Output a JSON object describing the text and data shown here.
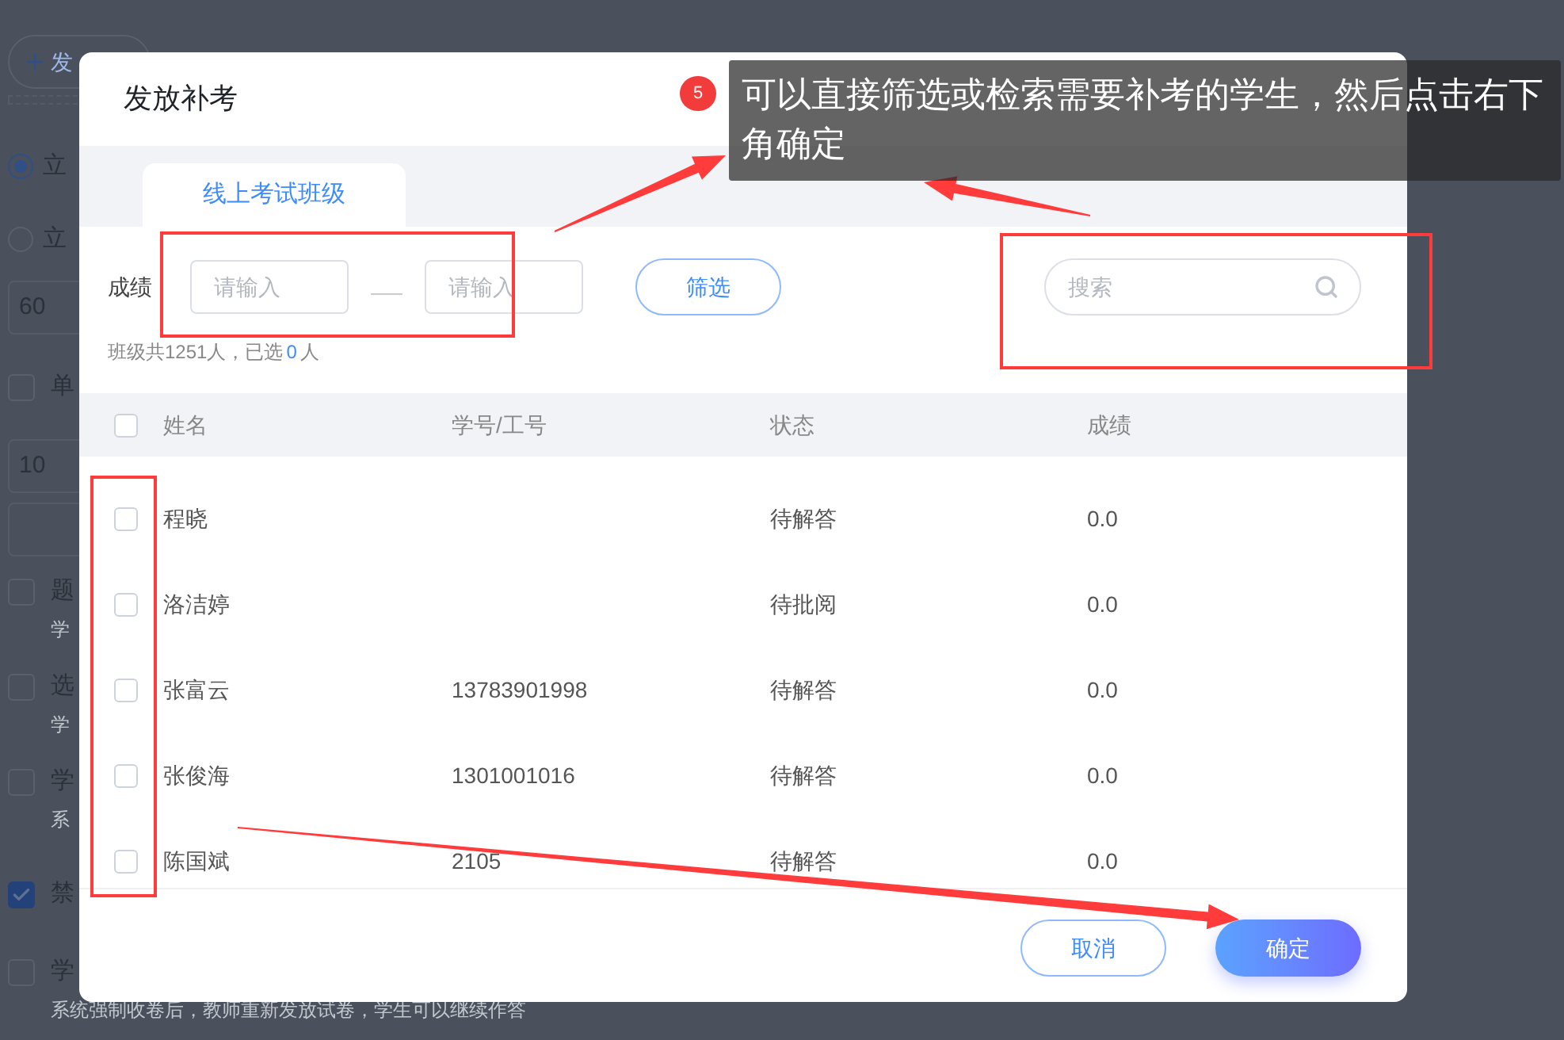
{
  "background": {
    "add_button": "发",
    "rows": [
      {
        "kind": "radio",
        "label": "立",
        "selected": true
      },
      {
        "kind": "radio",
        "label": "立",
        "selected": false
      },
      {
        "kind": "input",
        "value": "60"
      },
      {
        "kind": "checkbox",
        "label": "单",
        "checked": false
      },
      {
        "kind": "input",
        "value": "10"
      },
      {
        "kind": "blank_input"
      },
      {
        "kind": "checkbox",
        "label": "题",
        "checked": false,
        "caption": "学"
      },
      {
        "kind": "checkbox",
        "label": "选",
        "checked": false,
        "caption": "学"
      },
      {
        "kind": "checkbox",
        "label": "学",
        "checked": false,
        "caption": "系"
      },
      {
        "kind": "checkbox",
        "label": "禁",
        "checked": true
      },
      {
        "kind": "checkbox",
        "label": "学",
        "checked": false,
        "caption": "系统强制收卷后，教师重新发放试卷，学生可以继续作答"
      }
    ]
  },
  "dialog": {
    "title": "发放补考",
    "tabs": [
      {
        "label": "线上考试班级",
        "selected": true
      }
    ],
    "filter": {
      "label": "成绩",
      "min_placeholder": "请输入",
      "max_placeholder": "请输入",
      "button": "筛选"
    },
    "search": {
      "placeholder": "搜索"
    },
    "summary": {
      "prefix": "班级共1251人，已选",
      "count": "0",
      "suffix": "人"
    },
    "table": {
      "select_all_checked": false,
      "columns": [
        "姓名",
        "学号/工号",
        "状态",
        "成绩"
      ],
      "rows": [
        {
          "checked": false,
          "name": "程晓",
          "status": "待解答",
          "score": "0.0"
        },
        {
          "checked": false,
          "name": "洛洁婷",
          "status": "待批阅",
          "score": "0.0"
        },
        {
          "checked": false,
          "name": "张富云",
          "id": "13783901998",
          "status": "待解答",
          "score": "0.0"
        },
        {
          "checked": false,
          "name": "张俊海",
          "id": "1301001016",
          "status": "待解答",
          "score": "0.0"
        },
        {
          "checked": false,
          "name": "陈国斌",
          "id": "2105",
          "status": "待解答",
          "score": "0.0"
        }
      ]
    },
    "buttons": {
      "cancel": "取消",
      "confirm": "确定"
    }
  },
  "annotation": {
    "step": "5",
    "text": "可以直接筛选或检索需要补考的学生，然后点击右下角确定"
  }
}
